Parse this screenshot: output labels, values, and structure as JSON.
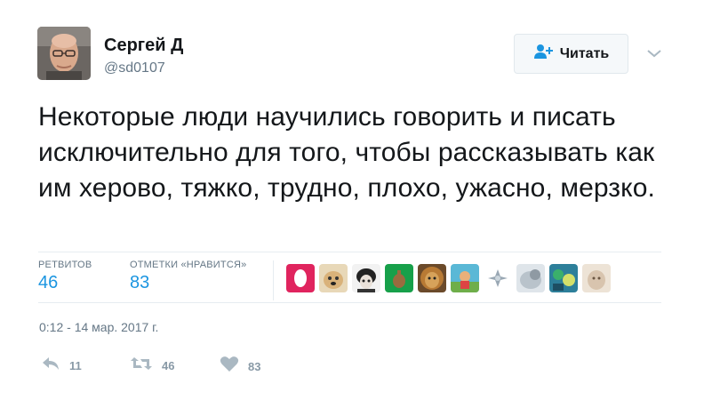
{
  "author": {
    "name": "Сергей Д",
    "handle": "@sd0107"
  },
  "follow_button": {
    "label": "Читать"
  },
  "tweet": {
    "text": "Некоторые люди научились говорить и писать исключительно для того, чтобы рассказывать как им херово, тяжко, трудно, плохо, ужасно, мерзко.",
    "timestamp": "0:12 - 14 мар. 2017 г."
  },
  "stats": {
    "retweets_label": "РЕТВИТОВ",
    "retweets_count": "46",
    "likes_label": "ОТМЕТКИ «НРАВИТСЯ»",
    "likes_count": "83"
  },
  "actions": {
    "reply_count": "11",
    "retweet_count": "46",
    "like_count": "83"
  },
  "colors": {
    "accent": "#1b95e0",
    "muted": "#657786",
    "icon": "#aab8c2"
  },
  "icons": [
    "follow-user-icon",
    "chevron-down-icon",
    "reply-icon",
    "retweet-icon",
    "heart-icon"
  ]
}
